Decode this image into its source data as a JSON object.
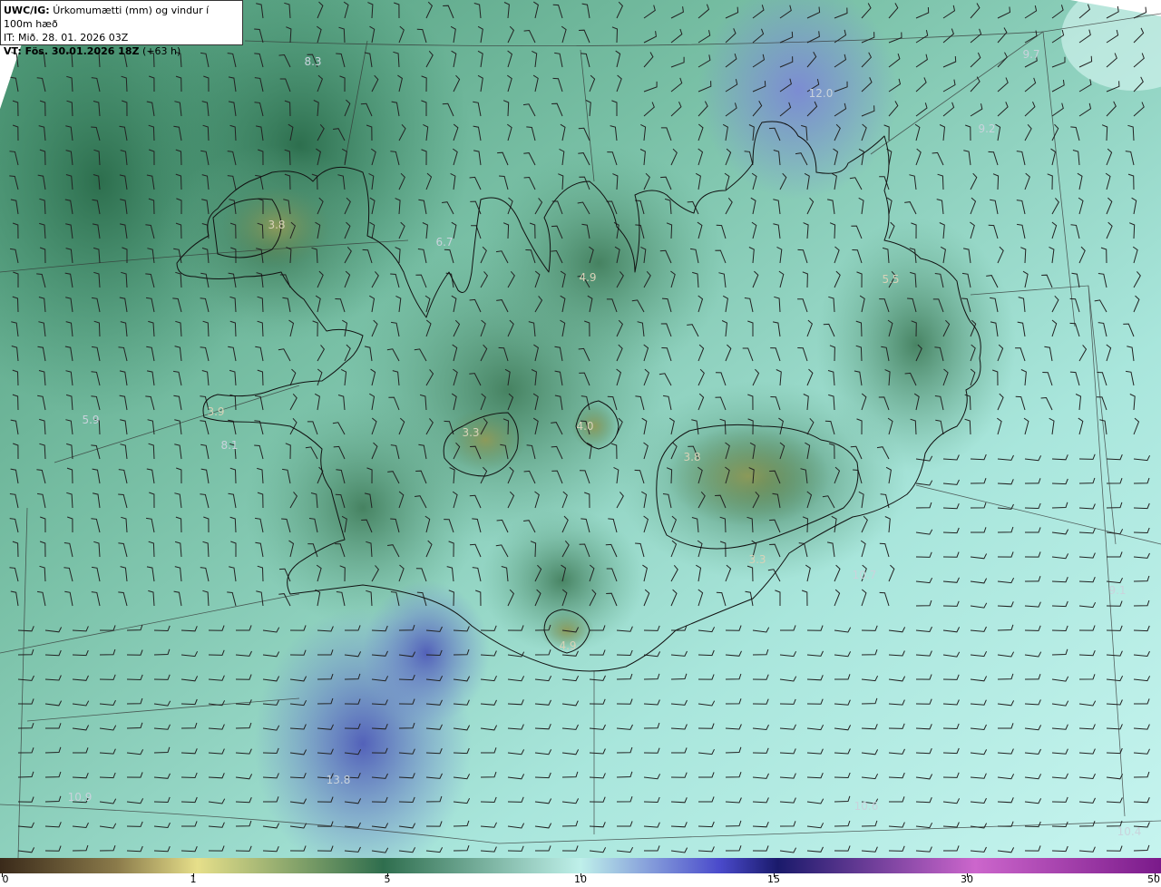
{
  "header": {
    "model_code": "UWC/IG:",
    "title_text": "Úrkomumætti (mm) og vindur í 100m hæð",
    "it_prefix": "IT:",
    "it_text": "Mið. 28. 01. 2026 03Z",
    "vt_label": "VT: Fös. 30.01.2026 18Z",
    "vt_lead": "(+63 h)"
  },
  "map_labels": [
    {
      "id": "nw-sea",
      "text": "8.3",
      "sea": true
    },
    {
      "id": "ne-sea",
      "text": "12.0",
      "sea": true
    },
    {
      "id": "far-ne",
      "text": "9.2",
      "sea": true
    },
    {
      "id": "east-sea",
      "text": "9.1",
      "sea": true
    },
    {
      "id": "westfjords",
      "text": "3.8",
      "sea": false
    },
    {
      "id": "huna",
      "text": "6.7",
      "sea": true
    },
    {
      "id": "trolla",
      "text": "4.9",
      "sea": false
    },
    {
      "id": "northeast",
      "text": "5.5",
      "sea": false
    },
    {
      "id": "west-sea",
      "text": "5.9",
      "sea": true
    },
    {
      "id": "snaefells",
      "text": "3.9",
      "sea": false
    },
    {
      "id": "faxa",
      "text": "8.1",
      "sea": true
    },
    {
      "id": "langjokull",
      "text": "3.3",
      "sea": false
    },
    {
      "id": "hofsjokull",
      "text": "4.0",
      "sea": false
    },
    {
      "id": "vatnajokull",
      "text": "3.8",
      "sea": false
    },
    {
      "id": "oraefa",
      "text": "3.3",
      "sea": false
    },
    {
      "id": "se-sea",
      "text": "10.7",
      "sea": true
    },
    {
      "id": "east-far",
      "text": "9.7",
      "sea": true
    },
    {
      "id": "myrdals",
      "text": "4.9",
      "sea": false
    },
    {
      "id": "sw-sea",
      "text": "13.8",
      "sea": true
    },
    {
      "id": "sw-far",
      "text": "10.9",
      "sea": true
    },
    {
      "id": "south-sea",
      "text": "10.6",
      "sea": true
    },
    {
      "id": "se-far",
      "text": "10.4",
      "sea": true
    }
  ],
  "colorbar": {
    "ticks": [
      "0",
      "1",
      "5",
      "10",
      "15",
      "30",
      "50"
    ],
    "stops": [
      "#3a2a1a",
      "#8a7a4a",
      "#e6df8a",
      "#2f6e4e",
      "#bff0ea",
      "#4a4acb",
      "#1a1a6b",
      "#cc66cc",
      "#7a1a8a"
    ]
  }
}
